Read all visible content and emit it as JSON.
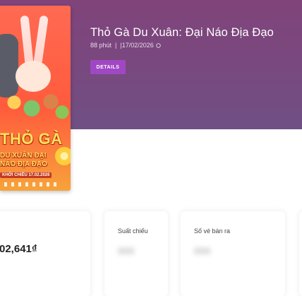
{
  "movie": {
    "title": "Thỏ Gà Du Xuân: Đại Náo Địa Đạo",
    "duration": "88 phút",
    "separator": "|",
    "release_date": "|17/02/2026",
    "date_icon": "clock-icon",
    "details_label": "DETAILS"
  },
  "poster": {
    "title_line1": "THỎ GÀ",
    "title_line2": "DU XUÂN ĐẠI NÁO ĐỊA ĐẠO",
    "date_text": "KHỞI CHIẾU 17.02.2026"
  },
  "stats": {
    "revenue_value": "02,641₫",
    "showtimes_label": "Suất chiếu",
    "showtimes_value": "000",
    "tickets_label": "Số vé bán ra",
    "tickets_value": "000"
  },
  "colors": {
    "hero": "#7a477e",
    "button": "#a048c4"
  }
}
